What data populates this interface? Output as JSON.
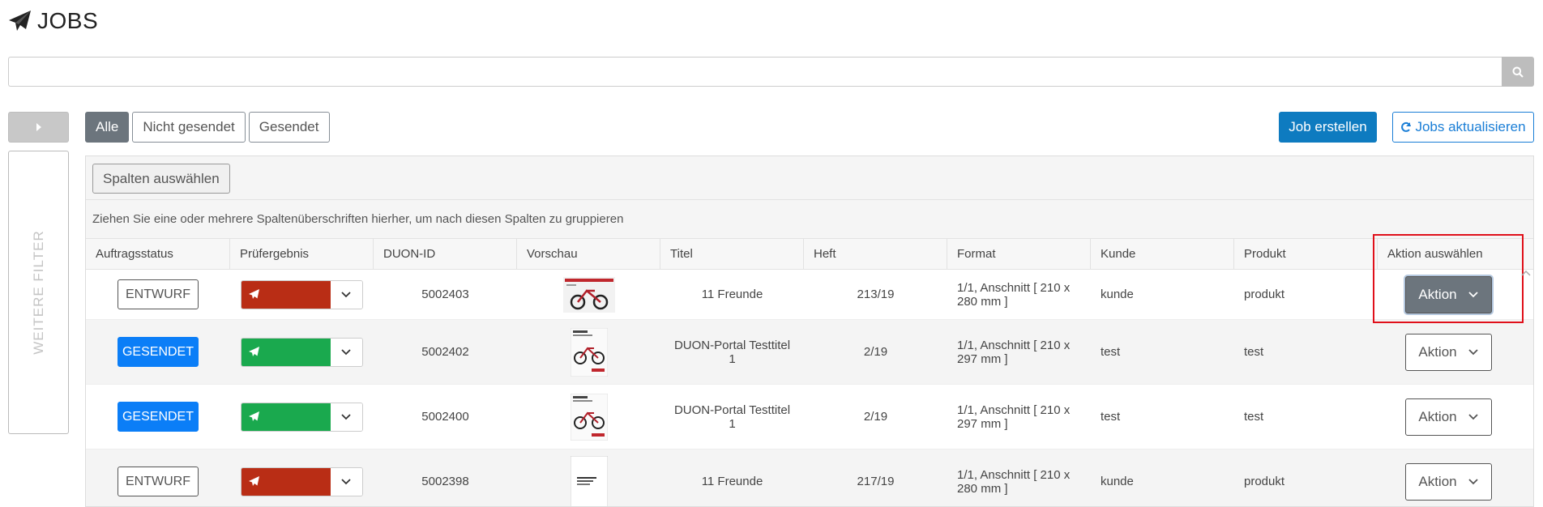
{
  "page": {
    "title": "JOBS",
    "icon": "paper-plane-icon"
  },
  "search": {
    "value": "",
    "placeholder": "",
    "button_icon": "search-icon"
  },
  "sidebar": {
    "toggle_icon": "caret-right-icon",
    "filter_label": "WEITERE FILTER"
  },
  "tabs": [
    {
      "label": "Alle",
      "active": true
    },
    {
      "label": "Nicht gesendet",
      "active": false
    },
    {
      "label": "Gesendet",
      "active": false
    }
  ],
  "actions": {
    "create_label": "Job erstellen",
    "refresh_label": "Jobs aktualisieren",
    "refresh_icon": "refresh-icon"
  },
  "grid": {
    "columns_button": "Spalten auswählen",
    "group_hint": "Ziehen Sie eine oder mehrere Spaltenüberschriften hierher, um nach diesen Spalten zu gruppieren",
    "headers": [
      "Auftragsstatus",
      "Prüfergebnis",
      "DUON-ID",
      "Vorschau",
      "Titel",
      "Heft",
      "Format",
      "Kunde",
      "Produkt",
      "Aktion auswählen"
    ],
    "rows": [
      {
        "status": "ENTWURF",
        "check": "red",
        "id": "5002403",
        "preview": "bike-landscape",
        "title": "11 Freunde",
        "issue": "213/19",
        "format": "1/1, Anschnitt [ 210 x 280 mm ]",
        "customer": "kunde",
        "product": "produkt",
        "action": "Aktion",
        "action_active": true
      },
      {
        "status": "GESENDET",
        "check": "green",
        "id": "5002402",
        "preview": "bike-portrait",
        "title": "DUON-Portal Testtitel 1",
        "issue": "2/19",
        "format": "1/1, Anschnitt [ 210 x 297 mm ]",
        "customer": "test",
        "product": "test",
        "action": "Aktion",
        "action_active": false
      },
      {
        "status": "GESENDET",
        "check": "green",
        "id": "5002400",
        "preview": "bike-portrait",
        "title": "DUON-Portal Testtitel 1",
        "issue": "2/19",
        "format": "1/1, Anschnitt [ 210 x 297 mm ]",
        "customer": "test",
        "product": "test",
        "action": "Aktion",
        "action_active": false
      },
      {
        "status": "ENTWURF",
        "check": "red",
        "id": "5002398",
        "preview": "text-page",
        "title": "11 Freunde",
        "issue": "217/19",
        "format": "1/1, Anschnitt [ 210 x 280 mm ]",
        "customer": "kunde",
        "product": "produkt",
        "action": "Aktion",
        "action_active": false
      }
    ]
  },
  "colors": {
    "primary": "#0e7bc0",
    "sent": "#0b7ef7",
    "check_fail": "#b92d15",
    "check_ok": "#1aa94e",
    "highlight": "#e0101a"
  }
}
